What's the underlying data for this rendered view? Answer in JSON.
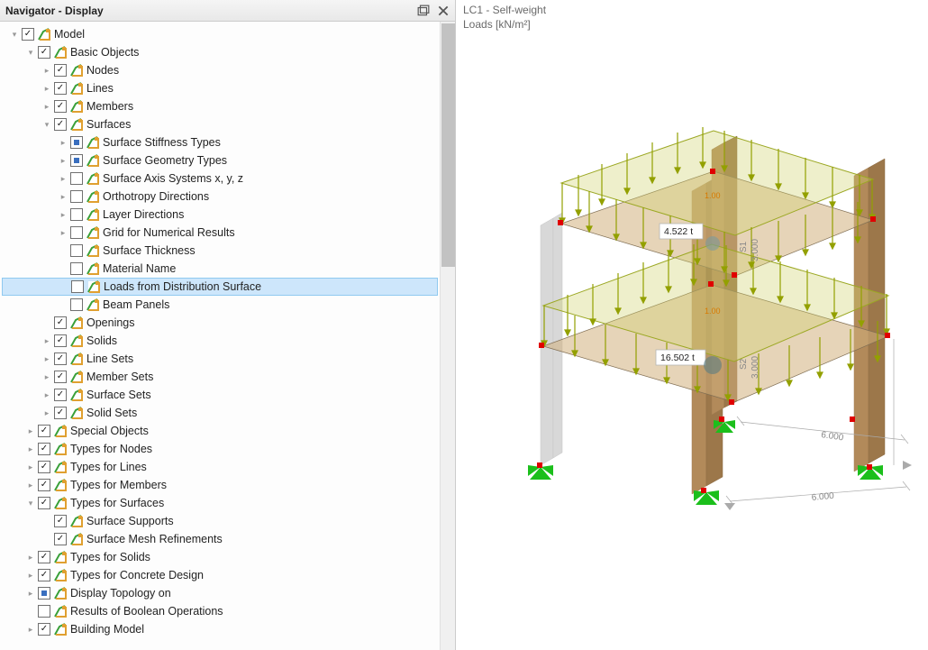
{
  "panel": {
    "title": "Navigator - Display"
  },
  "viewport": {
    "loadcase": "LC1 - Self-weight",
    "loads_label": "Loads [kN/m²]"
  },
  "labels": {
    "mass_upper": "4.522 t",
    "mass_lower": "16.502 t",
    "s1": "S1",
    "s2": "S2",
    "h1": "3.000",
    "h2": "3.000",
    "dim1": "6.000",
    "dim2": "6.000",
    "load_val": "1.00"
  },
  "tree": {
    "model": "Model",
    "basic_objects": "Basic Objects",
    "nodes": "Nodes",
    "lines": "Lines",
    "members": "Members",
    "surfaces": "Surfaces",
    "surface_stiffness_types": "Surface Stiffness Types",
    "surface_geometry_types": "Surface Geometry Types",
    "surface_axis": "Surface Axis Systems x, y, z",
    "ortho_dir": "Orthotropy Directions",
    "layer_dir": "Layer Directions",
    "grid_num": "Grid for Numerical Results",
    "surface_thickness": "Surface Thickness",
    "material_name": "Material Name",
    "loads_from_dist": "Loads from Distribution Surface",
    "beam_panels": "Beam Panels",
    "openings": "Openings",
    "solids": "Solids",
    "line_sets": "Line Sets",
    "member_sets": "Member Sets",
    "surface_sets": "Surface Sets",
    "solid_sets": "Solid Sets",
    "special_objects": "Special Objects",
    "types_nodes": "Types for Nodes",
    "types_lines": "Types for Lines",
    "types_members": "Types for Members",
    "types_surfaces": "Types for Surfaces",
    "surface_supports": "Surface Supports",
    "surface_mesh_ref": "Surface Mesh Refinements",
    "types_solids": "Types for Solids",
    "types_concrete": "Types for Concrete Design",
    "display_topology": "Display Topology on",
    "results_bool": "Results of Boolean Operations",
    "building_model": "Building Model"
  }
}
